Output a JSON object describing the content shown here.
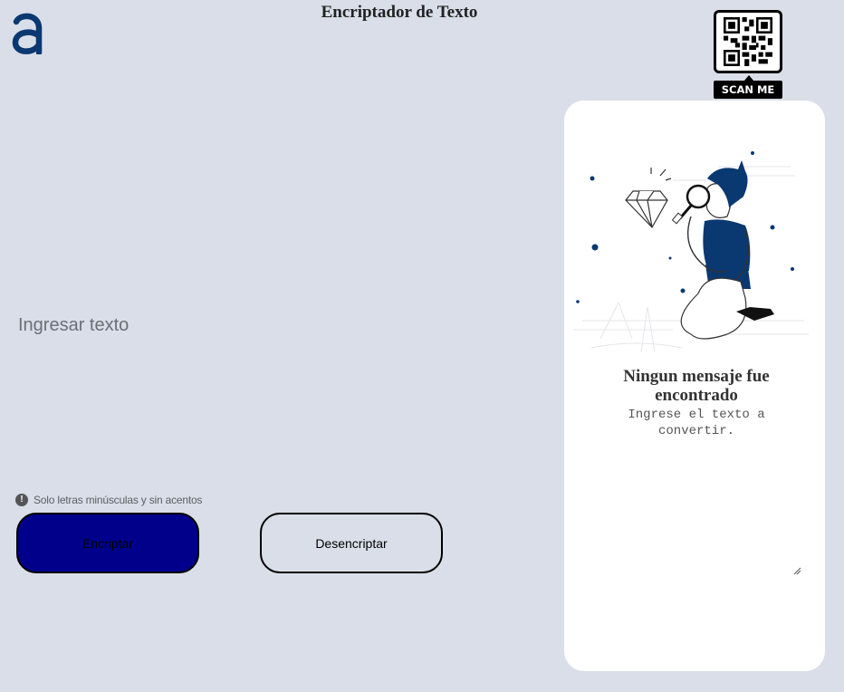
{
  "header": {
    "title": "Encriptador de Texto",
    "logo_icon": "alura-a-logo-icon",
    "qr_label": "SCAN ME"
  },
  "input": {
    "placeholder": "Ingresar texto"
  },
  "hint": {
    "icon": "exclamation-circle-icon",
    "text": "Solo letras minúsculas y sin acentos"
  },
  "buttons": {
    "encrypt_label": "Encriptar",
    "decrypt_label": "Desencriptar"
  },
  "output": {
    "title": "Ningun mensaje fue encontrado",
    "subtitle": "Ingrese el texto a convertir.",
    "illustration": "person-with-magnifier-illustration"
  },
  "colors": {
    "background": "#d9dee8",
    "accent": "#00008b",
    "brand": "#0a3871"
  }
}
